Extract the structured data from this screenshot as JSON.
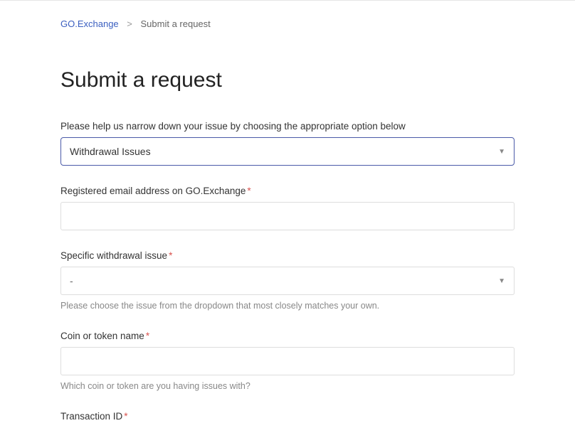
{
  "breadcrumb": {
    "root": "GO.Exchange",
    "current": "Submit a request"
  },
  "page_title": "Submit a request",
  "fields": {
    "issue_type": {
      "label": "Please help us narrow down your issue by choosing the appropriate option below",
      "value": "Withdrawal Issues"
    },
    "email": {
      "label": "Registered email address on GO.Exchange",
      "value": ""
    },
    "specific_issue": {
      "label": "Specific withdrawal issue",
      "value": "-",
      "hint": "Please choose the issue from the dropdown that most closely matches your own."
    },
    "coin": {
      "label": "Coin or token name",
      "value": "",
      "hint": "Which coin or token are you having issues with?"
    },
    "txid": {
      "label": "Transaction ID"
    }
  }
}
